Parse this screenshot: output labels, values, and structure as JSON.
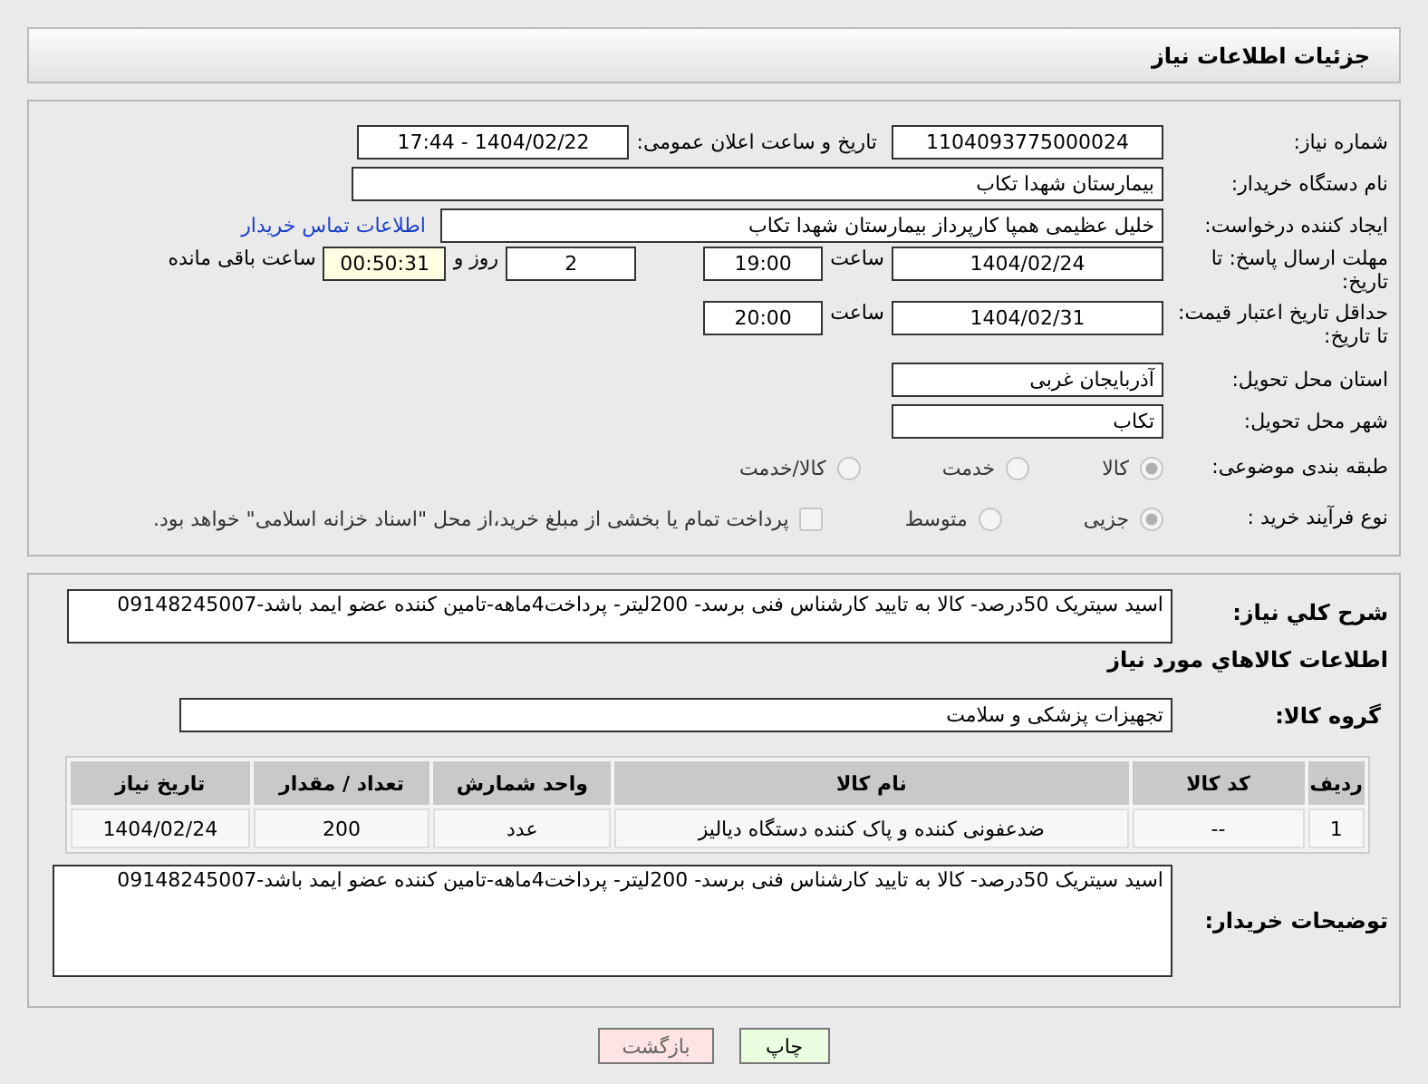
{
  "header": {
    "title": "جزئیات اطلاعات نیاز"
  },
  "need_number": {
    "label": "شماره نیاز:",
    "value": "1104093775000024"
  },
  "announce": {
    "label": "تاریخ و ساعت اعلان عمومی:",
    "value": "1404/02/22 - 17:44"
  },
  "buyer_org": {
    "label": "نام دستگاه خریدار:",
    "value": "بیمارستان شهدا تکاب"
  },
  "requester": {
    "label": "ایجاد کننده درخواست:",
    "value": "خلیل عظیمی همپا کارپرداز بیمارستان شهدا تکاب",
    "link": "اطلاعات تماس خریدار"
  },
  "deadline": {
    "label": "مهلت ارسال پاسخ: تا تاریخ:",
    "date": "1404/02/24",
    "time_label": "ساعت",
    "time": "19:00",
    "days": "2",
    "days_label": "روز و",
    "remaining": "00:50:31",
    "remaining_label": "ساعت باقی مانده"
  },
  "validity": {
    "label": "حداقل تاریخ اعتبار قیمت: تا تاریخ:",
    "date": "1404/02/31",
    "time_label": "ساعت",
    "time": "20:00"
  },
  "province": {
    "label": "استان محل تحویل:",
    "value": "آذربایجان غربی"
  },
  "city": {
    "label": "شهر محل تحویل:",
    "value": "تکاب"
  },
  "category": {
    "label": "طبقه بندی موضوعی:",
    "options": [
      {
        "label": "کالا",
        "selected": true
      },
      {
        "label": "خدمت",
        "selected": false
      },
      {
        "label": "کالا/خدمت",
        "selected": false
      }
    ]
  },
  "process": {
    "label": "نوع فرآیند خرید :",
    "options": [
      {
        "label": "جزیی",
        "selected": true
      },
      {
        "label": "متوسط",
        "selected": false
      }
    ],
    "treasury": {
      "checked": false,
      "text": "پرداخت تمام یا بخشی از مبلغ خرید،از محل \"اسناد خزانه اسلامی\" خواهد بود."
    }
  },
  "description": {
    "label": "شرح کلي نياز:",
    "value": "اسید سیتریک 50درصد- کالا به تایید کارشناس فنی برسد- 200لیتر-  پرداخت4ماهه-تامین کننده عضو ایمد باشد-09148245007"
  },
  "goods_title": "اطلاعات کالاهاي مورد نياز",
  "group": {
    "label": "گروه کالا:",
    "value": "تجهیزات پزشکی و سلامت"
  },
  "table": {
    "columns": [
      "ردیف",
      "کد کالا",
      "نام کالا",
      "واحد شمارش",
      "تعداد / مقدار",
      "تاریخ نیاز"
    ],
    "rows": [
      [
        "1",
        "--",
        "ضدعفونی کننده و پاک کننده دستگاه دیالیز",
        "عدد",
        "200",
        "1404/02/24"
      ]
    ]
  },
  "buyer_notes": {
    "label": "توضیحات خریدار:",
    "value": "اسید سیتریک 50درصد- کالا به تایید کارشناس فنی برسد- 200لیتر-  پرداخت4ماهه-تامین کننده عضو ایمد باشد-09148245007"
  },
  "buttons": [
    {
      "label": "چاپ",
      "kind": "print"
    },
    {
      "label": "بازگشت",
      "kind": "back"
    }
  ]
}
